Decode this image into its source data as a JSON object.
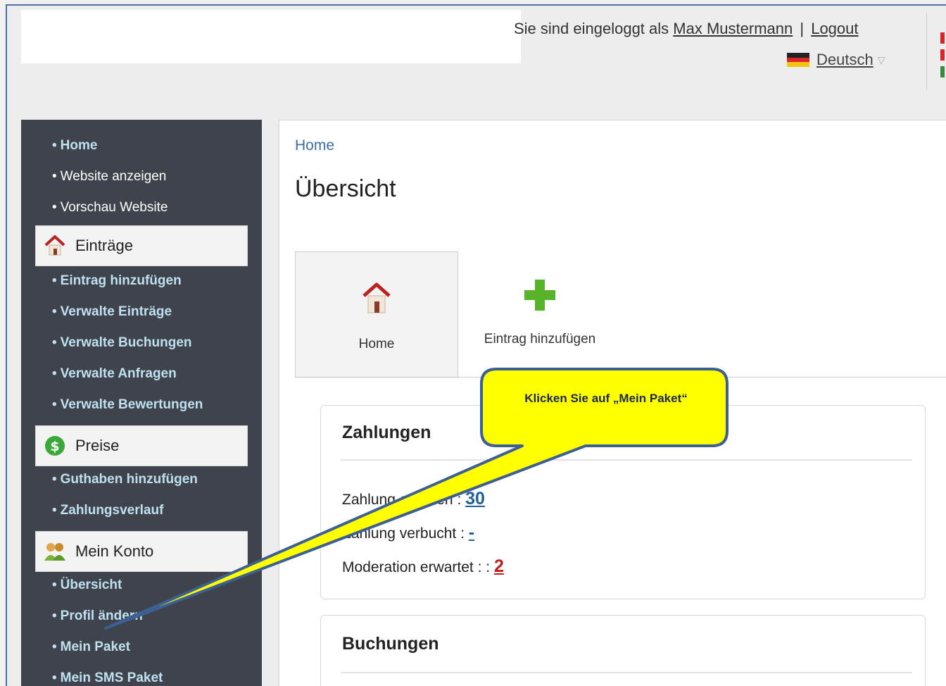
{
  "header": {
    "login_prefix": "Sie sind eingeloggt als",
    "user_name": "Max Mustermann",
    "separator": "|",
    "logout_label": "Logout",
    "language_label": "Deutsch"
  },
  "sidebar": {
    "top_links": [
      {
        "label": "Home"
      },
      {
        "label": "Website anzeigen"
      },
      {
        "label": "Vorschau Website"
      }
    ],
    "sections": [
      {
        "title": "Einträge",
        "icon": "house-icon",
        "items": [
          "Eintrag hinzufügen",
          "Verwalte Einträge",
          "Verwalte Buchungen",
          "Verwalte Anfragen",
          "Verwalte Bewertungen"
        ]
      },
      {
        "title": "Preise",
        "icon": "dollar-icon",
        "items": [
          "Guthaben hinzufügen",
          "Zahlungsverlauf"
        ]
      },
      {
        "title": "Mein Konto",
        "icon": "users-icon",
        "items": [
          "Übersicht",
          "Profil ändern",
          "Mein Paket",
          "Mein SMS Paket"
        ]
      }
    ]
  },
  "main": {
    "breadcrumb": "Home",
    "title": "Übersicht",
    "tabs": [
      {
        "label": "Home",
        "icon": "house-icon"
      },
      {
        "label": "Eintrag hinzufügen",
        "icon": "plus-icon"
      }
    ],
    "payments": {
      "title": "Zahlungen",
      "rows": [
        {
          "label": "Zahlung erhalten :",
          "value": "30"
        },
        {
          "label": "Zahlung verbucht :",
          "value": "-"
        },
        {
          "label": "Moderation erwartet : :",
          "value": "2"
        }
      ]
    },
    "bookings": {
      "title": "Buchungen"
    }
  },
  "callout": {
    "text": "Klicken Sie auf „Mein Paket“"
  },
  "colors": {
    "sidebar_bg": "#3f434b",
    "sidebar_link": "#bfe0f0",
    "callout_fill": "#ffff00",
    "callout_border": "#3d5f91",
    "value_blue": "#1f5f9a",
    "value_red": "#c01c1c"
  }
}
